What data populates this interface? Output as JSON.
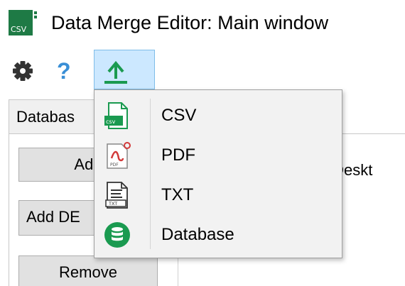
{
  "window": {
    "title": "Data Merge Editor: Main window",
    "app_icon_text": "CSV"
  },
  "toolbar": {
    "help_glyph": "?"
  },
  "tabs": [
    {
      "label": "Databas"
    }
  ],
  "buttons": {
    "add": "Add",
    "add_db": "Add DE",
    "remove": "Remove"
  },
  "list": {
    "path_fragment": "\\Deskt"
  },
  "export_menu": {
    "items": [
      {
        "label": "CSV",
        "icon": "csv-file-icon"
      },
      {
        "label": "PDF",
        "icon": "pdf-file-icon"
      },
      {
        "label": "TXT",
        "icon": "txt-file-icon"
      },
      {
        "label": "Database",
        "icon": "database-icon"
      }
    ]
  },
  "colors": {
    "accent_green": "#1a9a50",
    "selected_bg": "#cce8ff",
    "help_blue": "#3a8fd6"
  }
}
